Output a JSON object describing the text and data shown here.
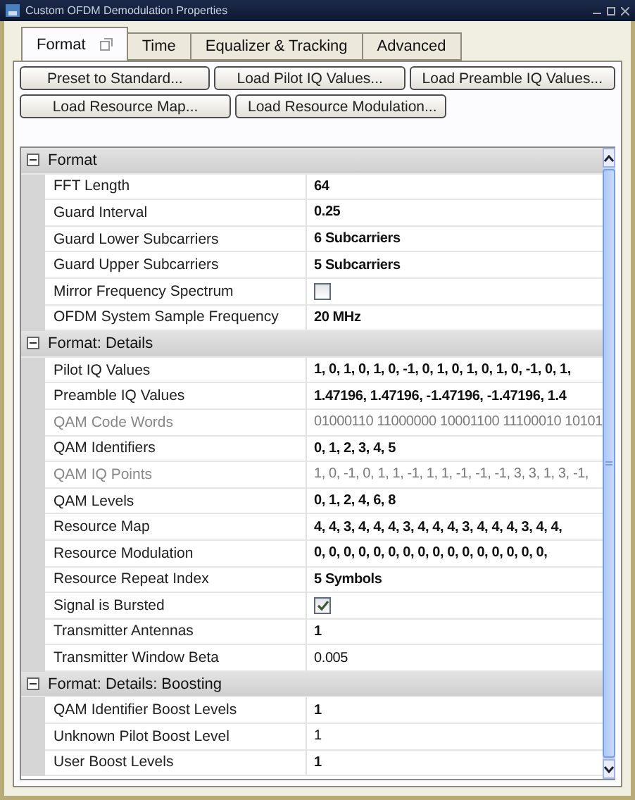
{
  "window": {
    "title": "Custom OFDM Demodulation Properties"
  },
  "tabs": [
    {
      "label": "Format",
      "selected": true
    },
    {
      "label": "Time",
      "selected": false
    },
    {
      "label": "Equalizer & Tracking",
      "selected": false
    },
    {
      "label": "Advanced",
      "selected": false
    }
  ],
  "button_rows": [
    [
      "Preset to Standard...",
      "Load Pilot IQ Values...",
      "Load Preamble IQ Values..."
    ],
    [
      "Load Resource Map...",
      "Load Resource Modulation..."
    ]
  ],
  "grid": {
    "categories": [
      {
        "title": "Format",
        "expanded": true,
        "rows": [
          {
            "name": "FFT Length",
            "kind": "text",
            "value": "64",
            "bold": true,
            "disabled": false
          },
          {
            "name": "Guard Interval",
            "kind": "text",
            "value": "0.25",
            "bold": true,
            "disabled": false
          },
          {
            "name": "Guard Lower Subcarriers",
            "kind": "text",
            "value": "6 Subcarriers",
            "bold": true,
            "disabled": false
          },
          {
            "name": "Guard Upper Subcarriers",
            "kind": "text",
            "value": "5 Subcarriers",
            "bold": true,
            "disabled": false
          },
          {
            "name": "Mirror Frequency Spectrum",
            "kind": "checkbox",
            "checked": false,
            "disabled": false
          },
          {
            "name": "OFDM System Sample Frequency",
            "kind": "text",
            "value": "20 MHz",
            "bold": true,
            "disabled": false
          }
        ]
      },
      {
        "title": "Format: Details",
        "expanded": true,
        "rows": [
          {
            "name": "Pilot IQ Values",
            "kind": "text",
            "value": "1, 0, 1, 0, 1, 0, -1, 0, 1, 0, 1, 0, 1, 0, -1, 0, 1,",
            "bold": true,
            "disabled": false
          },
          {
            "name": "Preamble IQ Values",
            "kind": "text",
            "value": "1.47196, 1.47196, -1.47196, -1.47196, 1.4",
            "bold": true,
            "disabled": false
          },
          {
            "name": "QAM Code Words",
            "kind": "text",
            "value": "01000110 11000000 10001100 11100010 10101",
            "bold": false,
            "disabled": true
          },
          {
            "name": "QAM Identifiers",
            "kind": "text",
            "value": "0, 1, 2, 3, 4, 5",
            "bold": true,
            "disabled": false
          },
          {
            "name": "QAM IQ Points",
            "kind": "text",
            "value": "1, 0, -1, 0, 1, 1, -1, 1, 1, -1, -1, -1, 3, 3, 1, 3, -1,",
            "bold": false,
            "disabled": true
          },
          {
            "name": "QAM Levels",
            "kind": "text",
            "value": "0, 1, 2, 4, 6, 8",
            "bold": true,
            "disabled": false
          },
          {
            "name": "Resource Map",
            "kind": "text",
            "value": "4, 4, 3, 4, 4, 4, 3, 4, 4, 4, 3, 4, 4, 4, 3, 4, 4,",
            "bold": true,
            "disabled": false
          },
          {
            "name": "Resource Modulation",
            "kind": "text",
            "value": "0, 0, 0, 0, 0, 0, 0, 0, 0, 0, 0, 0, 0, 0, 0, 0,",
            "bold": true,
            "disabled": false
          },
          {
            "name": "Resource Repeat Index",
            "kind": "text",
            "value": "5 Symbols",
            "bold": true,
            "disabled": false
          },
          {
            "name": "Signal is Bursted",
            "kind": "checkbox",
            "checked": true,
            "disabled": false
          },
          {
            "name": "Transmitter Antennas",
            "kind": "text",
            "value": "1",
            "bold": true,
            "disabled": false
          },
          {
            "name": "Transmitter Window Beta",
            "kind": "text",
            "value": "0.005",
            "bold": false,
            "disabled": false
          }
        ]
      },
      {
        "title": "Format: Details: Boosting",
        "expanded": true,
        "rows": [
          {
            "name": "QAM Identifier Boost Levels",
            "kind": "text",
            "value": "1",
            "bold": true,
            "disabled": false
          },
          {
            "name": "Unknown Pilot Boost Level",
            "kind": "text",
            "value": "1",
            "bold": false,
            "disabled": false
          },
          {
            "name": "User Boost Levels",
            "kind": "text",
            "value": "1",
            "bold": true,
            "disabled": false
          }
        ]
      }
    ]
  }
}
